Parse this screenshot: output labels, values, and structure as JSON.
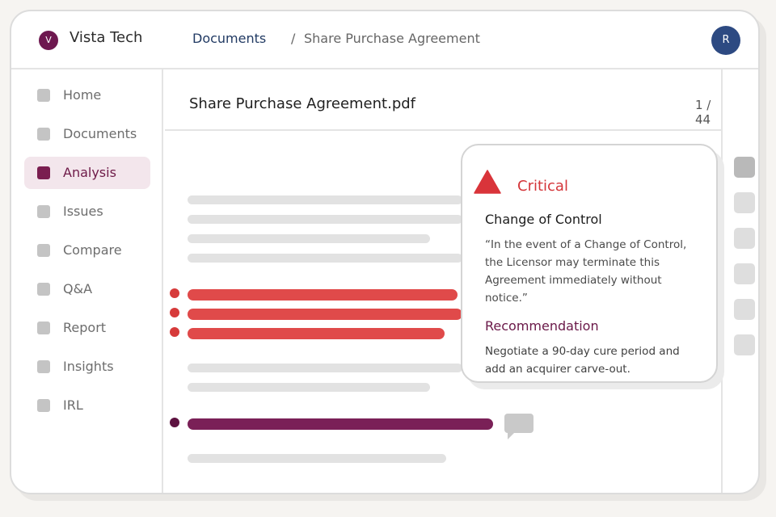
{
  "header": {
    "logo_letter": "V",
    "brand": "Vista Tech",
    "breadcrumb": {
      "parent": "Documents",
      "separator": "/",
      "current": "Share Purchase Agreement"
    },
    "avatar_initial": "R"
  },
  "sidebar": {
    "items": [
      {
        "label": "Home",
        "active": false
      },
      {
        "label": "Documents",
        "active": false
      },
      {
        "label": "Analysis",
        "active": true
      },
      {
        "label": "Issues",
        "active": false
      },
      {
        "label": "Compare",
        "active": false
      },
      {
        "label": "Q&A",
        "active": false
      },
      {
        "label": "Report",
        "active": false
      },
      {
        "label": "Insights",
        "active": false
      },
      {
        "label": "IRL",
        "active": false
      }
    ]
  },
  "document": {
    "file_name": "Share Purchase Agreement.pdf",
    "page_indicator": "1 / 44"
  },
  "finding": {
    "severity": "Critical",
    "title": "Change of Control",
    "quote": "“In the event of a Change of Control, the Licensor may terminate this Agreement immediately without notice.”",
    "recommendation_label": "Recommendation",
    "recommendation": "Negotiate a 90-day cure period and add an acquirer carve-out."
  },
  "icons": {
    "logo": "vista-logo-icon",
    "severity": "warning-triangle-icon",
    "comment": "comment-bubble-icon"
  },
  "colors": {
    "brand": "#6e1850",
    "critical": "#d4363a",
    "highlight_red": "#e04a4a",
    "highlight_plum": "#7a2057",
    "breadcrumb_link": "#213a63",
    "avatar": "#2d4a82"
  }
}
